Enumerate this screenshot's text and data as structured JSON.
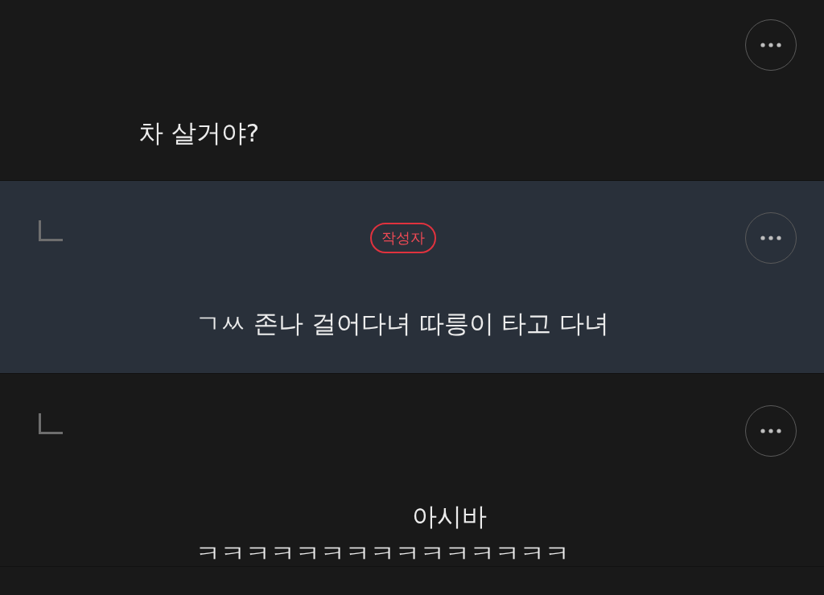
{
  "comments": [
    {
      "reply": false,
      "highlighted": false,
      "text": "차 살거야?"
    },
    {
      "reply": true,
      "highlighted": true,
      "badge": "작성자",
      "text": "ㄱㅆ 존나 걸어다녀 따릉이 타고 다녀"
    },
    {
      "reply": true,
      "highlighted": false,
      "text": "아시바 ㅋㅋㅋㅋㅋㅋㅋㅋㅋㅋㅋㅋㅋㅋㅋ",
      "indent_first_line": true
    }
  ]
}
